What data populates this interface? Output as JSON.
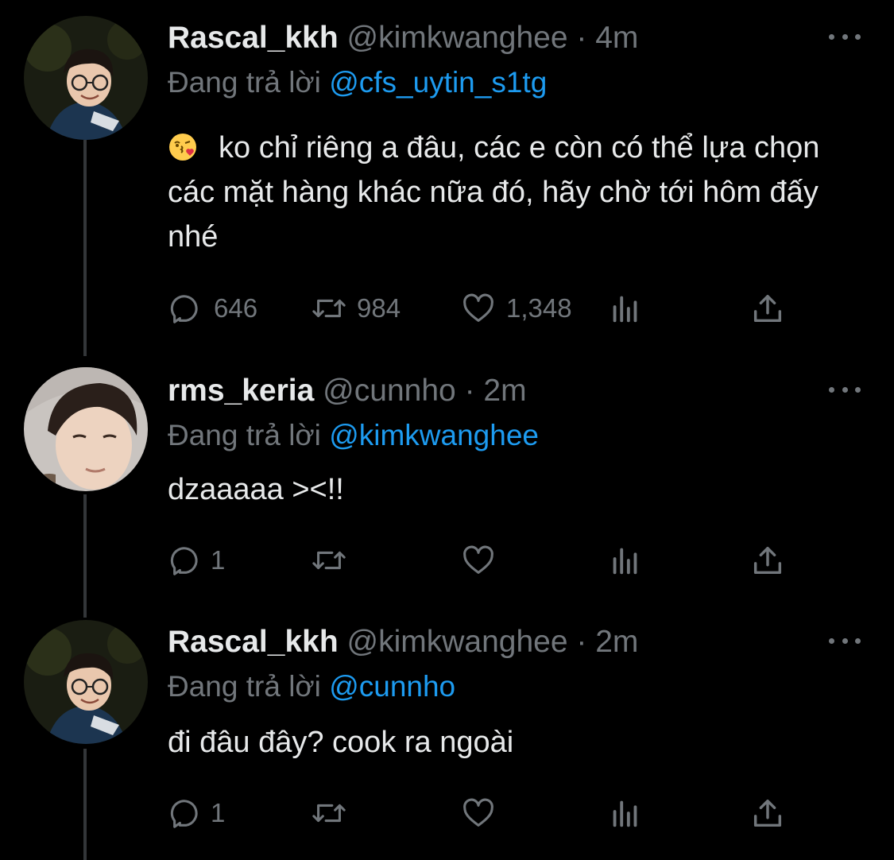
{
  "tweets": [
    {
      "display_name": "Rascal_kkh",
      "handle": "@kimkwanghee",
      "separator": "·",
      "time": "4m",
      "replying_prefix": "Đang trả lời",
      "replying_to": "@cfs_uytin_s1tg",
      "emoji": "kissing-face-with-heart",
      "text": "ko chỉ riêng a đâu, các e còn có thể lựa chọn các mặt hàng khác nữa đó, hãy chờ tới hôm đấy nhé",
      "reply_count": "646",
      "retweet_count": "984",
      "like_count": "1,348"
    },
    {
      "display_name": "rms_keria",
      "handle": "@cunnho",
      "separator": "·",
      "time": "2m",
      "replying_prefix": "Đang trả lời",
      "replying_to": "@kimkwanghee",
      "text": "dzaaaaa ><!!",
      "reply_count": "1",
      "retweet_count": "",
      "like_count": ""
    },
    {
      "display_name": "Rascal_kkh",
      "handle": "@kimkwanghee",
      "separator": "·",
      "time": "2m",
      "replying_prefix": "Đang trả lời",
      "replying_to": "@cunnho",
      "text": "đi đâu đây? cook ra ngoài",
      "reply_count": "1",
      "retweet_count": "",
      "like_count": ""
    }
  ],
  "colors": {
    "background": "#000000",
    "text": "#e7e9ea",
    "secondary": "#71767b",
    "link": "#1d9bf0",
    "thread_line": "#333639"
  }
}
